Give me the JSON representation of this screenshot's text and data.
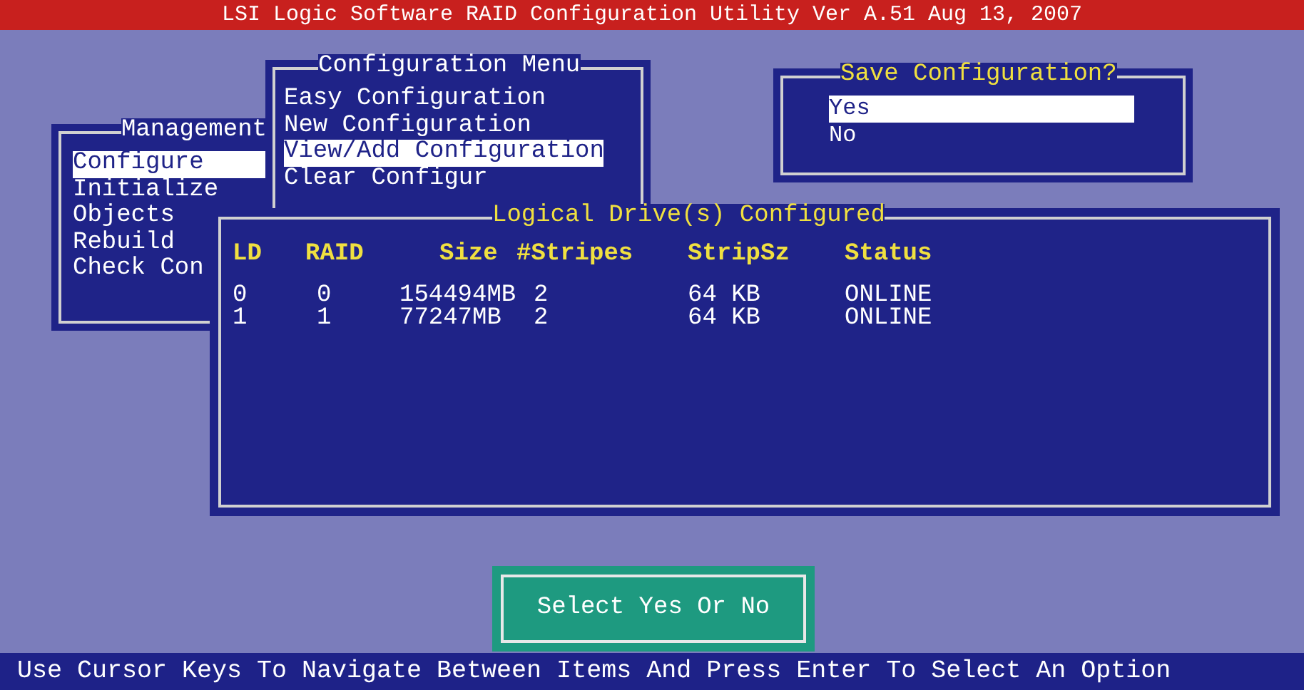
{
  "title_bar": "LSI Logic Software RAID Configuration Utility Ver A.51 Aug 13, 2007",
  "management_menu": {
    "title": "Management",
    "items": [
      {
        "label": "Configure",
        "selected": true
      },
      {
        "label": "Initialize",
        "selected": false
      },
      {
        "label": "Objects",
        "selected": false
      },
      {
        "label": "Rebuild",
        "selected": false
      },
      {
        "label": "Check Con",
        "selected": false
      }
    ]
  },
  "configuration_menu": {
    "title": "Configuration Menu",
    "items": [
      {
        "label": "Easy Configuration",
        "selected": false
      },
      {
        "label": "New Configuration",
        "selected": false
      },
      {
        "label": "View/Add Configuration",
        "selected": true
      },
      {
        "label": "Clear Configur",
        "selected": false
      }
    ]
  },
  "save_dialog": {
    "title": "Save Configuration?",
    "options": [
      {
        "label": "Yes",
        "selected": true
      },
      {
        "label": "No",
        "selected": false
      }
    ]
  },
  "logical_drives": {
    "title": "Logical Drive(s) Configured",
    "columns": [
      "LD",
      "RAID",
      "Size",
      "#Stripes",
      "StripSz",
      "Status"
    ],
    "rows": [
      [
        "0",
        "0",
        "154494MB",
        "2",
        "64 KB",
        "ONLINE"
      ],
      [
        "1",
        "1",
        "77247MB",
        "2",
        "64 KB",
        "ONLINE"
      ]
    ]
  },
  "prompt": "Select Yes Or No",
  "status_bar": "Use Cursor Keys To Navigate Between Items And Press Enter To Select An Option"
}
